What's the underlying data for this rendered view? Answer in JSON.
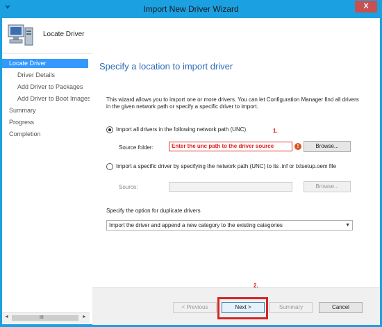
{
  "window": {
    "title": "Import New Driver Wizard",
    "close_glyph": "X",
    "accent": "#1ba1e2"
  },
  "header": {
    "page_title": "Locate Driver"
  },
  "sidebar": {
    "items": [
      {
        "label": "Locate Driver",
        "active": true
      },
      {
        "label": "Driver Details"
      },
      {
        "label": "Add Driver to Packages"
      },
      {
        "label": "Add Driver to Boot Images"
      },
      {
        "label": "Summary"
      },
      {
        "label": "Progress"
      },
      {
        "label": "Completion"
      }
    ],
    "scroll_left": "◄",
    "scroll_right": "►",
    "scroll_grip": "III"
  },
  "main": {
    "title": "Specify a location to import driver",
    "description": "This wizard allows you to import one or more drivers. You can let Configuration Manager find all drivers in the given network path or specify a specific driver to import.",
    "option_all": "Import all drivers in the following network path (UNC)",
    "source_folder_label": "Source folder:",
    "source_folder_value": "Enter the unc path to the driver   source",
    "browse_label": "Browse...",
    "option_specific": "Import a specific driver by specifying the network path (UNC) to its .inf or txtsetup.oem file",
    "source_label": "Source:",
    "source_value": "",
    "browse2_label": "Browse...",
    "duplicate_label": "Specify the option for duplicate drivers",
    "duplicate_selected": "Import the driver and append a new category to the existing categories",
    "error_glyph": "!"
  },
  "annotations": {
    "one": "1.",
    "two": "2."
  },
  "footer": {
    "previous": "< Previous",
    "next": "Next >",
    "summary": "Summary",
    "cancel": "Cancel"
  }
}
